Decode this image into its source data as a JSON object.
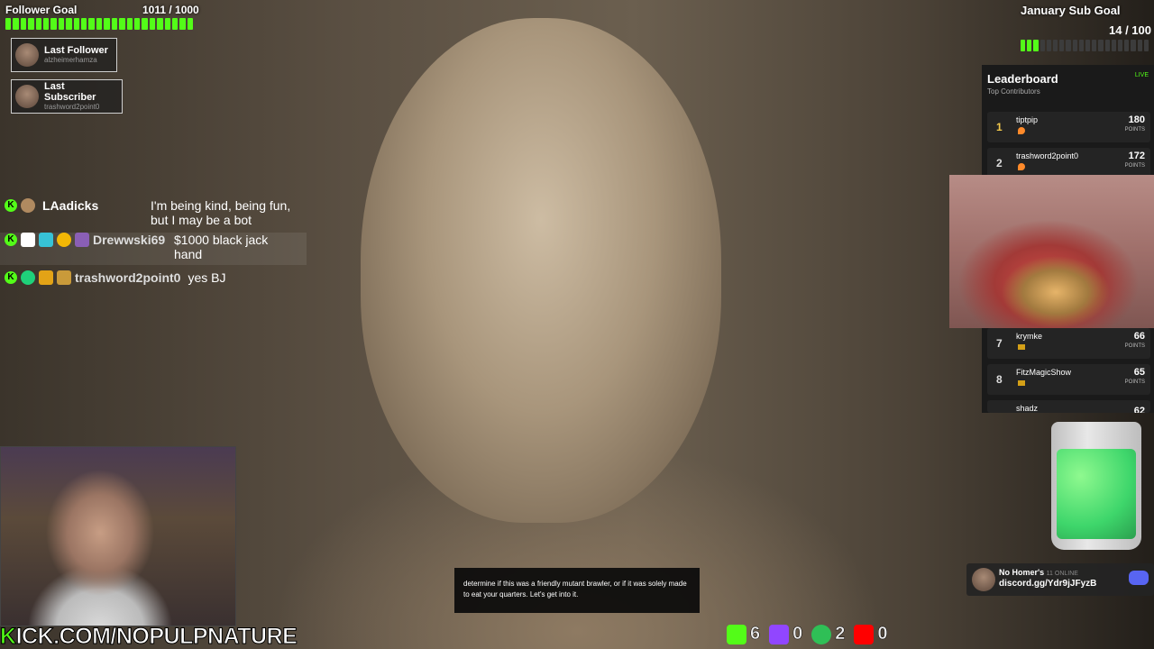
{
  "follower_goal": {
    "title": "Follower Goal",
    "count": "1011 / 1000",
    "progress": 1.0
  },
  "last_follower": {
    "label": "Last Follower",
    "user": "alzheimerhamza"
  },
  "last_subscriber": {
    "label": "Last Subscriber",
    "user": "trashword2point0"
  },
  "chat": [
    {
      "user": "LAadicks",
      "message": "I'm being kind, being fun, but I may be a bot"
    },
    {
      "user": "Drewwski69",
      "message": "$1000 black jack hand"
    },
    {
      "user": "trashword2point0",
      "message": "yes BJ"
    }
  ],
  "sub_goal": {
    "title": "January Sub Goal",
    "count": "14 / 100",
    "progress": 0.14
  },
  "leaderboard": {
    "title": "Leaderboard",
    "subtitle": "Top Contributors",
    "live": "LIVE",
    "points_label": "POINTS",
    "rows": [
      {
        "rank": "1",
        "user": "tiptpip",
        "points": "180"
      },
      {
        "rank": "2",
        "user": "trashword2point0",
        "points": "172"
      },
      {
        "rank": "7",
        "user": "krymke",
        "points": "66"
      },
      {
        "rank": "8",
        "user": "FitzMagicShow",
        "points": "65"
      },
      {
        "rank": "",
        "user": "shadz",
        "points": "62"
      }
    ]
  },
  "caption": "determine if this was a friendly mutant brawler, or if it was solely made to eat your quarters. Let's get into it.",
  "discord": {
    "name": "No Homer's",
    "online": "11 ONLINE",
    "link": "discord.gg/Ydr9jJFyzB"
  },
  "banner": {
    "k": "K",
    "text": "ICK.COM/NOPULPNATURE"
  },
  "stats": {
    "kick": "6",
    "twitch": "0",
    "other": "2",
    "youtube": "0"
  },
  "colors": {
    "kick_green": "#53fc18",
    "twitch": "#9146ff",
    "youtube": "#ff0000"
  }
}
